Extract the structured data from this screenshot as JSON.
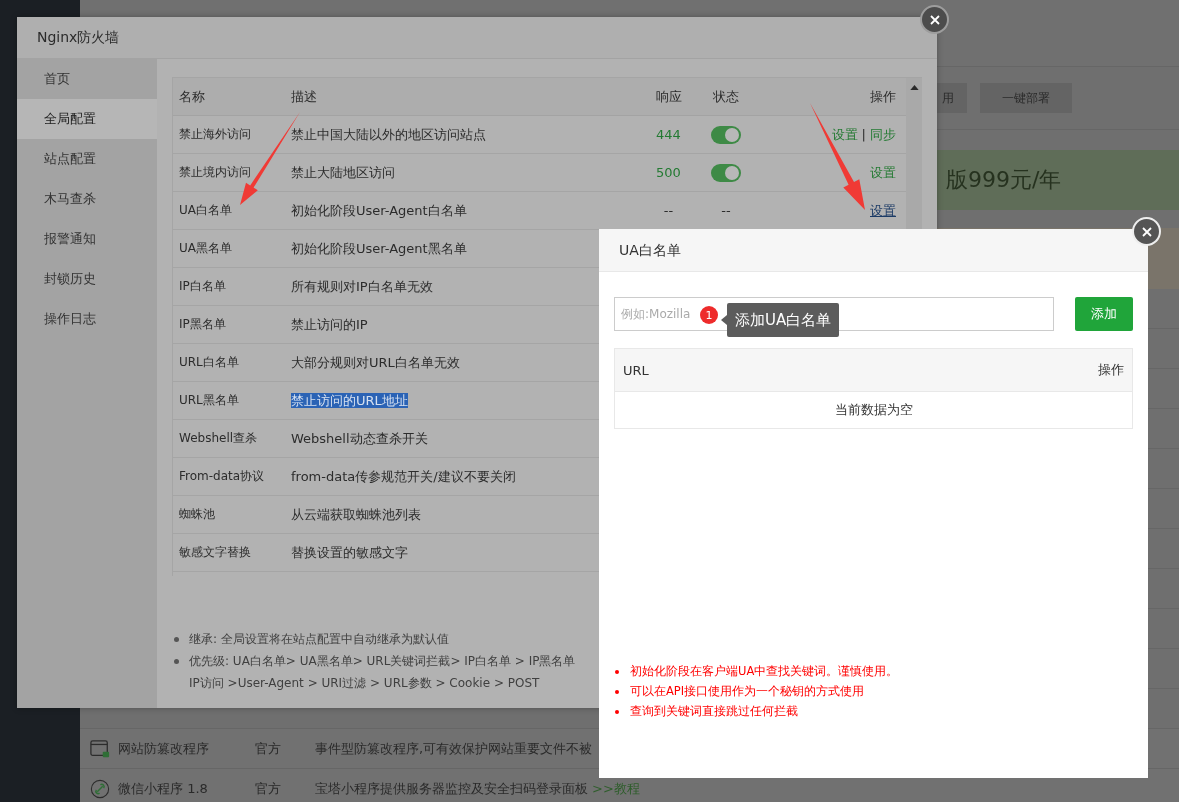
{
  "background_page": {
    "toolbar_buttons": [
      "用",
      "一键部署"
    ],
    "banner": "版999元/年",
    "rows": [
      {
        "name": "网站防篡改程序",
        "source": "官方",
        "description": "事件型防篡改程序,可有效保护网站重要文件不被"
      },
      {
        "name": "微信小程序 1.8",
        "source": "官方",
        "description": "宝塔小程序提供服务器监控及安全扫码登录面板",
        "link": ">>教程"
      }
    ]
  },
  "firewall_dialog": {
    "title": "Nginx防火墙",
    "sidebar": [
      {
        "label": "首页",
        "selected": false
      },
      {
        "label": "全局配置",
        "selected": true
      },
      {
        "label": "站点配置",
        "selected": false
      },
      {
        "label": "木马查杀",
        "selected": false
      },
      {
        "label": "报警通知",
        "selected": false
      },
      {
        "label": "封锁历史",
        "selected": false
      },
      {
        "label": "操作日志",
        "selected": false
      }
    ],
    "table": {
      "columns": [
        "名称",
        "描述",
        "响应",
        "状态",
        "操作"
      ],
      "action_separator": "|",
      "rows": [
        {
          "name": "禁止海外访问",
          "description": "禁止中国大陆以外的地区访问站点",
          "highlighted": false,
          "response": "444",
          "status": {
            "kind": "switch",
            "on": true
          },
          "actions": [
            {
              "label": "设置",
              "hovered": false
            },
            {
              "label": "同步",
              "hovered": false
            }
          ]
        },
        {
          "name": "禁止境内访问",
          "description": "禁止大陆地区访问",
          "highlighted": false,
          "response": "500",
          "status": {
            "kind": "switch",
            "on": true
          },
          "actions": [
            {
              "label": "设置",
              "hovered": false
            }
          ]
        },
        {
          "name": "UA白名单",
          "description": "初始化阶段User-Agent白名单",
          "highlighted": false,
          "response": "--",
          "status": {
            "kind": "text",
            "text": "--"
          },
          "actions": [
            {
              "label": "设置",
              "hovered": true
            }
          ]
        },
        {
          "name": "UA黑名单",
          "description": "初始化阶段User-Agent黑名单",
          "highlighted": false
        },
        {
          "name": "IP白名单",
          "description": "所有规则对IP白名单无效",
          "highlighted": false
        },
        {
          "name": "IP黑名单",
          "description": "禁止访问的IP",
          "highlighted": false
        },
        {
          "name": "URL白名单",
          "description": "大部分规则对URL白名单无效",
          "highlighted": false
        },
        {
          "name": "URL黑名单",
          "description": "禁止访问的URL地址",
          "highlighted": true
        },
        {
          "name": "Webshell查杀",
          "description": "Webshell动态查杀开关",
          "highlighted": false
        },
        {
          "name": "From-data协议",
          "description": "from-data传参规范开关/建议不要关闭",
          "highlighted": false
        },
        {
          "name": "蜘蛛池",
          "description": "从云端获取蜘蛛池列表",
          "highlighted": false
        },
        {
          "name": "敏感文字替换",
          "description": "替换设置的敏感文字",
          "highlighted": false
        }
      ]
    },
    "notes": [
      {
        "lines": [
          "继承: 全局设置将在站点配置中自动继承为默认值"
        ]
      },
      {
        "lines": [
          "优先级: UA白名单> UA黑名单> URL关键词拦截> IP白名单 > IP黑名单",
          "IP访问 >User-Agent > URI过滤 > URL参数 > Cookie > POST"
        ]
      }
    ]
  },
  "ua_dialog": {
    "title": "UA白名单",
    "input": {
      "placeholder": "例如:Mozilla"
    },
    "add_button": "添加",
    "tooltip": {
      "badge": "1",
      "text": "添加UA白名单"
    },
    "table": {
      "columns": [
        "URL",
        "操作"
      ],
      "empty_text": "当前数据为空"
    },
    "notes": [
      "初始化阶段在客户端UA中查找关键词。谨慎使用。",
      "可以在API接口使用作为一个秘钥的方式使用",
      "查询到关键词直接跳过任何拦截"
    ]
  }
}
